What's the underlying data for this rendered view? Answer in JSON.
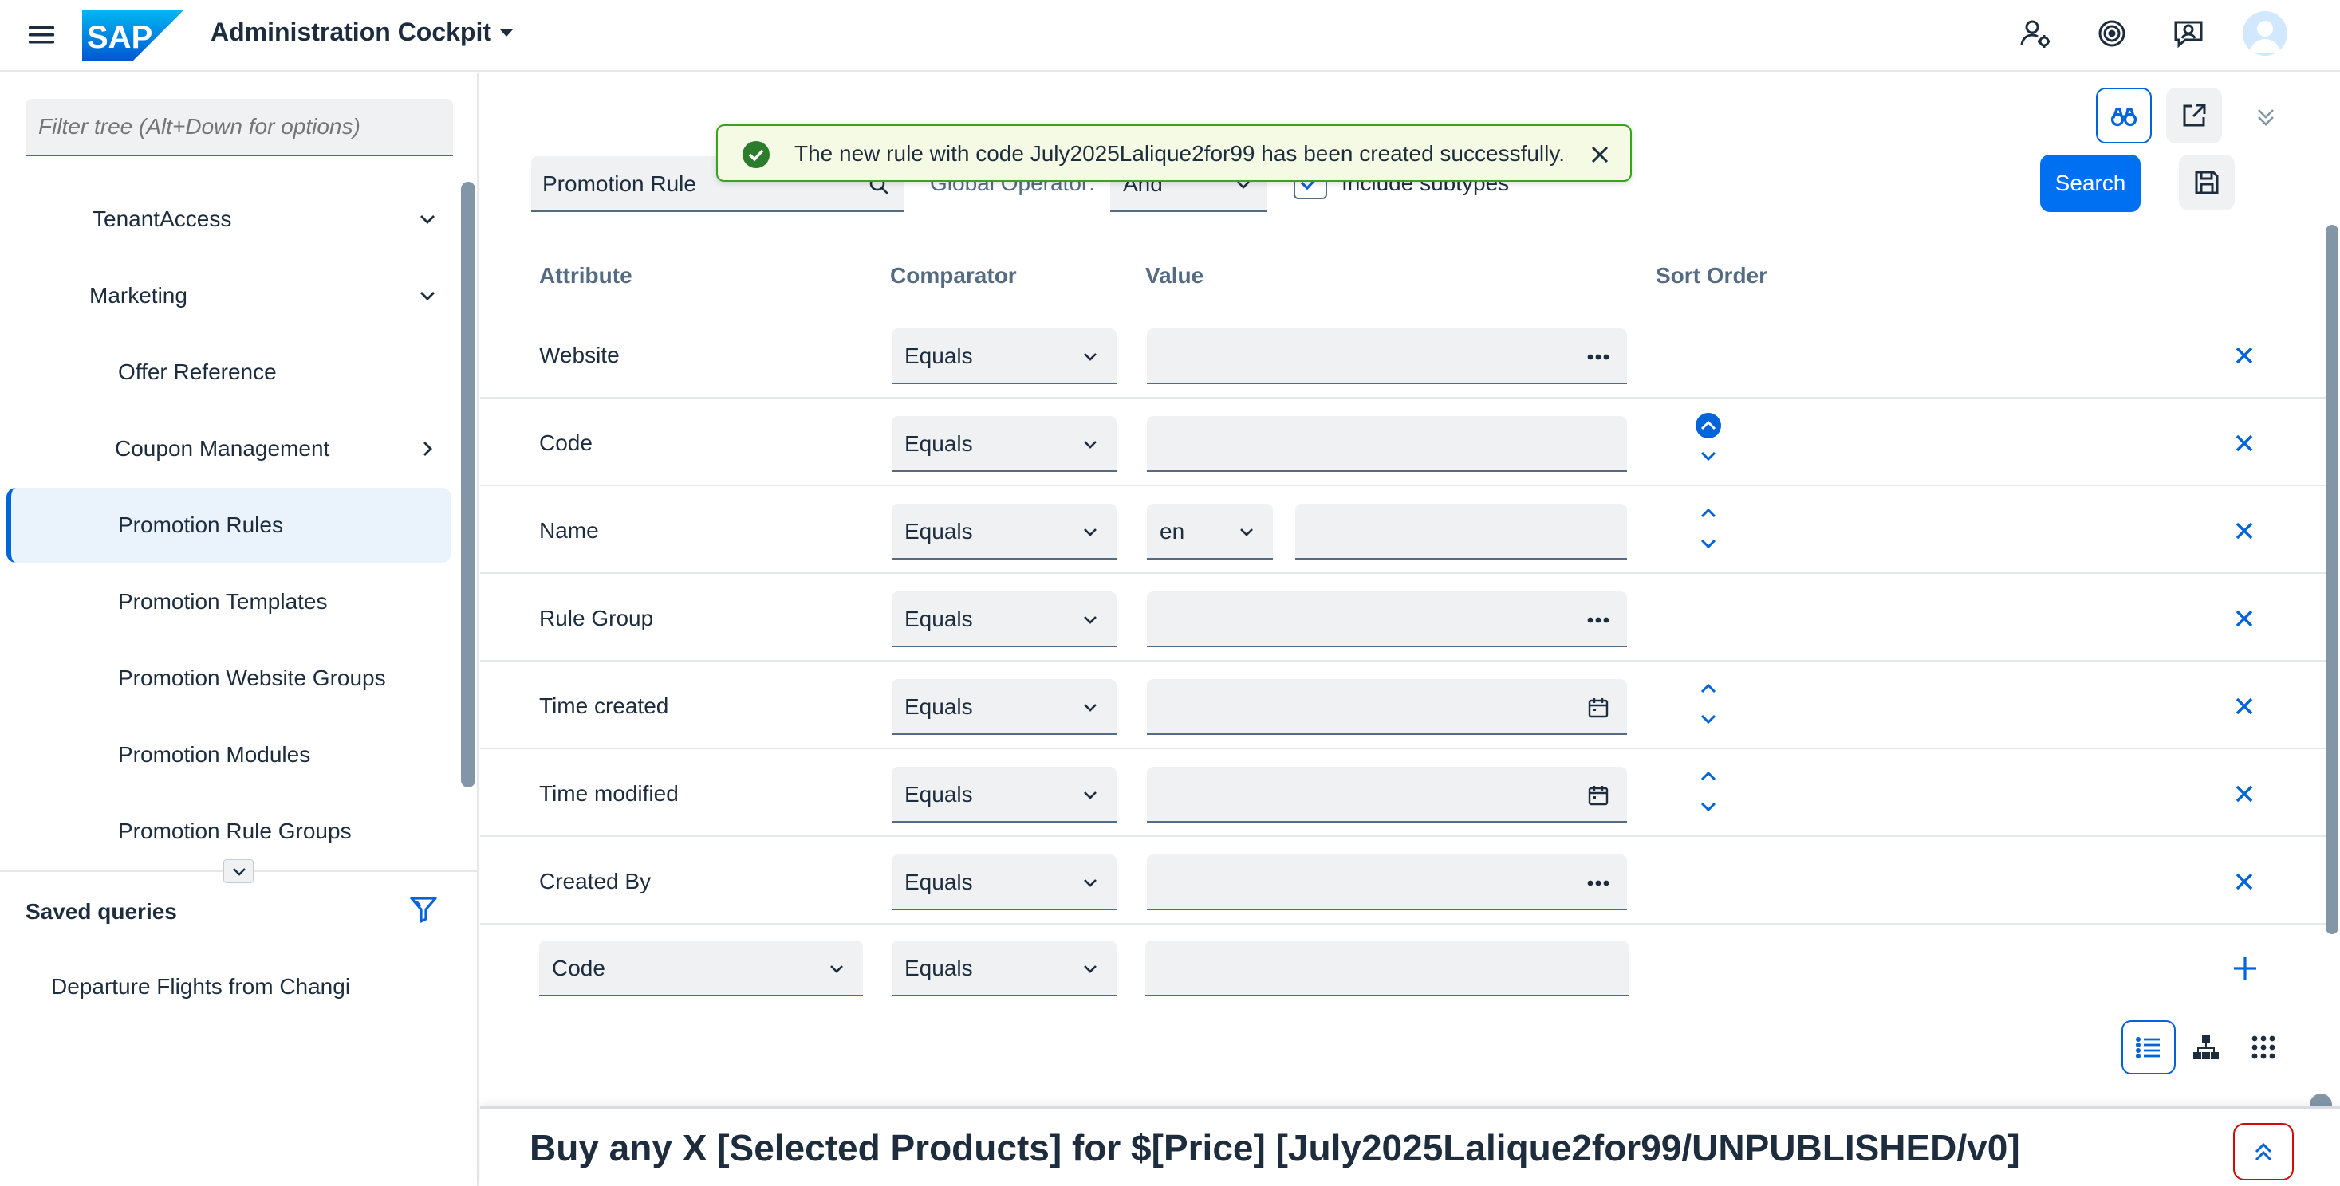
{
  "header": {
    "logo_text": "SAP",
    "app_title": "Administration Cockpit",
    "icons": [
      "user-settings-icon",
      "system-status-icon",
      "notifications-icon",
      "avatar-icon"
    ]
  },
  "sidebar": {
    "filter_placeholder": "Filter tree (Alt+Down for options)",
    "items": [
      {
        "label": "TenantAccess",
        "expander": "chevron-down"
      },
      {
        "label": "Marketing",
        "expander": "chevron-down"
      },
      {
        "label": "Offer Reference"
      },
      {
        "label": "Coupon Management",
        "expander": "chevron-right"
      },
      {
        "label": "Promotion Rules",
        "selected": true
      },
      {
        "label": "Promotion Templates"
      },
      {
        "label": "Promotion Website Groups"
      },
      {
        "label": "Promotion Modules"
      },
      {
        "label": "Promotion Rule Groups"
      }
    ],
    "saved_queries": {
      "title": "Saved queries",
      "items": [
        "Departure Flights from Changi"
      ]
    }
  },
  "toast": {
    "message": "The new rule with code July2025Lalique2for99 has been created successfully."
  },
  "search_bar": {
    "type_value": "Promotion Rule",
    "global_operator_label": "Global Operator:",
    "global_operator_value": "And",
    "include_subtypes_label": "Include subtypes",
    "include_subtypes_checked": true,
    "search_label": "Search"
  },
  "columns": {
    "attribute": "Attribute",
    "comparator": "Comparator",
    "value": "Value",
    "sort_order": "Sort Order"
  },
  "rows": [
    {
      "attribute": "Website",
      "comparator": "Equals",
      "value_kind": "reference"
    },
    {
      "attribute": "Code",
      "comparator": "Equals",
      "value_kind": "text",
      "sort_active": "up"
    },
    {
      "attribute": "Name",
      "comparator": "Equals",
      "value_kind": "localized",
      "locale": "en"
    },
    {
      "attribute": "Rule Group",
      "comparator": "Equals",
      "value_kind": "reference"
    },
    {
      "attribute": "Time created",
      "comparator": "Equals",
      "value_kind": "date"
    },
    {
      "attribute": "Time modified",
      "comparator": "Equals",
      "value_kind": "date"
    },
    {
      "attribute": "Created By",
      "comparator": "Equals",
      "value_kind": "reference"
    }
  ],
  "new_row": {
    "attribute": "Code",
    "comparator": "Equals"
  },
  "result": {
    "title": "Buy any X [Selected Products] for $[Price] [July2025Lalique2for99/UNPUBLISHED/v0]"
  },
  "colors": {
    "accent": "#0064d9",
    "button": "#0070f2",
    "success": "#36a41d",
    "text": "#1d2d3e",
    "muted": "#556b82",
    "field_bg": "#eff1f2"
  }
}
